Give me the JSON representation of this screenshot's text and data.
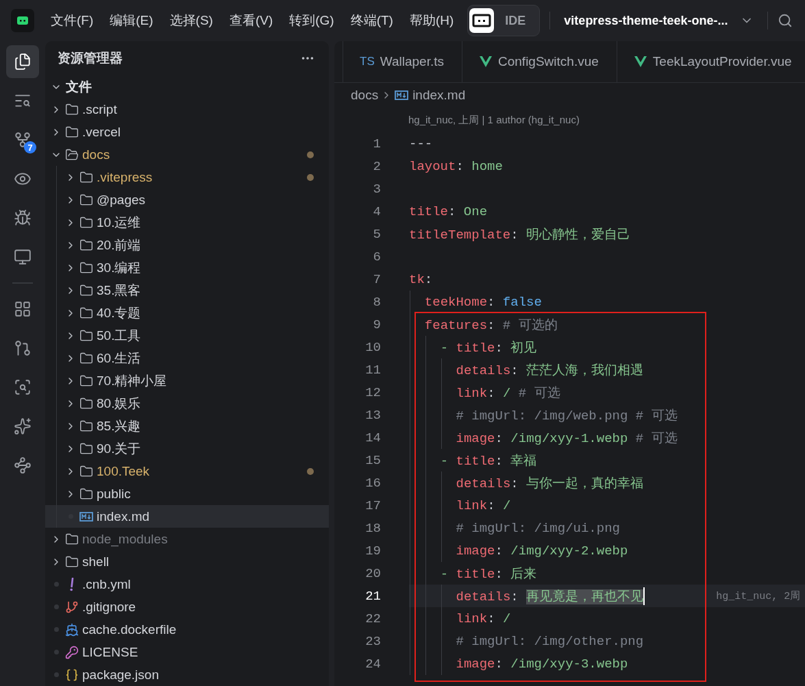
{
  "menu_bar": {
    "items": [
      "文件(F)",
      "编辑(E)",
      "选择(S)",
      "查看(V)",
      "转到(G)",
      "终端(T)",
      "帮助(H)"
    ],
    "mode_switch": {
      "label": "IDE",
      "on": true
    },
    "project": "vitepress-theme-teek-one-..."
  },
  "activity_bar": {
    "top": [
      {
        "kind": "explorer",
        "selected": true
      },
      {
        "kind": "search",
        "selected": false
      },
      {
        "kind": "source-control",
        "selected": false,
        "badge": "7"
      },
      {
        "kind": "preview",
        "selected": false
      },
      {
        "kind": "debug",
        "selected": false
      },
      {
        "kind": "remote",
        "selected": false
      }
    ],
    "bottom": [
      {
        "kind": "extensions",
        "selected": false
      },
      {
        "kind": "pull-requests",
        "selected": false
      },
      {
        "kind": "scan",
        "selected": false
      },
      {
        "kind": "ai",
        "selected": false
      },
      {
        "kind": "flow",
        "selected": false
      }
    ]
  },
  "explorer": {
    "title": "资源管理器",
    "section": {
      "label": "文件",
      "expanded": true
    },
    "tree": [
      {
        "label": ".script",
        "kind": "folder",
        "expanded": false,
        "modified": false,
        "ignored": false,
        "selected": false
      },
      {
        "label": ".vercel",
        "kind": "folder",
        "expanded": false,
        "modified": false,
        "ignored": false,
        "selected": false
      },
      {
        "label": "docs",
        "kind": "folder",
        "expanded": true,
        "modified": true,
        "ignored": false,
        "selected": false,
        "children": [
          {
            "label": ".vitepress",
            "kind": "folder",
            "expanded": false,
            "modified": true,
            "ignored": false,
            "selected": false
          },
          {
            "label": "@pages",
            "kind": "folder",
            "expanded": false,
            "modified": false,
            "ignored": false,
            "selected": false
          },
          {
            "label": "10.运维",
            "kind": "folder",
            "expanded": false,
            "modified": false,
            "ignored": false,
            "selected": false
          },
          {
            "label": "20.前端",
            "kind": "folder",
            "expanded": false,
            "modified": false,
            "ignored": false,
            "selected": false
          },
          {
            "label": "30.编程",
            "kind": "folder",
            "expanded": false,
            "modified": false,
            "ignored": false,
            "selected": false
          },
          {
            "label": "35.黑客",
            "kind": "folder",
            "expanded": false,
            "modified": false,
            "ignored": false,
            "selected": false
          },
          {
            "label": "40.专题",
            "kind": "folder",
            "expanded": false,
            "modified": false,
            "ignored": false,
            "selected": false
          },
          {
            "label": "50.工具",
            "kind": "folder",
            "expanded": false,
            "modified": false,
            "ignored": false,
            "selected": false
          },
          {
            "label": "60.生活",
            "kind": "folder",
            "expanded": false,
            "modified": false,
            "ignored": false,
            "selected": false
          },
          {
            "label": "70.精神小屋",
            "kind": "folder",
            "expanded": false,
            "modified": false,
            "ignored": false,
            "selected": false
          },
          {
            "label": "80.娱乐",
            "kind": "folder",
            "expanded": false,
            "modified": false,
            "ignored": false,
            "selected": false
          },
          {
            "label": "85.兴趣",
            "kind": "folder",
            "expanded": false,
            "modified": false,
            "ignored": false,
            "selected": false
          },
          {
            "label": "90.关于",
            "kind": "folder",
            "expanded": false,
            "modified": false,
            "ignored": false,
            "selected": false
          },
          {
            "label": "100.Teek",
            "kind": "folder",
            "expanded": false,
            "modified": true,
            "ignored": false,
            "selected": false
          },
          {
            "label": "public",
            "kind": "folder",
            "expanded": false,
            "modified": false,
            "ignored": false,
            "selected": false
          },
          {
            "label": "index.md",
            "kind": "markdown",
            "modified": false,
            "ignored": false,
            "selected": true
          }
        ]
      },
      {
        "label": "node_modules",
        "kind": "folder",
        "expanded": false,
        "modified": false,
        "ignored": true,
        "selected": false
      },
      {
        "label": "shell",
        "kind": "folder",
        "expanded": false,
        "modified": false,
        "ignored": false,
        "selected": false
      },
      {
        "label": ".cnb.yml",
        "kind": "yaml",
        "modified": false,
        "ignored": false,
        "selected": false
      },
      {
        "label": ".gitignore",
        "kind": "git",
        "modified": false,
        "ignored": false,
        "selected": false
      },
      {
        "label": "cache.dockerfile",
        "kind": "docker",
        "modified": false,
        "ignored": false,
        "selected": false
      },
      {
        "label": "LICENSE",
        "kind": "license",
        "modified": false,
        "ignored": false,
        "selected": false
      },
      {
        "label": "package.json",
        "kind": "json",
        "modified": false,
        "ignored": false,
        "selected": false
      }
    ]
  },
  "editor": {
    "tabs": [
      {
        "label": "Wallaper.ts",
        "kind": "ts",
        "icon_text": "TS",
        "selected": false
      },
      {
        "label": "ConfigSwitch.vue",
        "kind": "vue",
        "selected": false
      },
      {
        "label": "TeekLayoutProvider.vue",
        "kind": "vue",
        "selected": false
      }
    ],
    "breadcrumb": [
      {
        "label": "docs",
        "kind": "folder"
      },
      {
        "label": "index.md",
        "kind": "markdown"
      }
    ],
    "blame_header": "hg_it_nuc, 上周 | 1 author (hg_it_nuc)",
    "lines": [
      {
        "number": "1",
        "current": false,
        "boxed": false,
        "tokens": [
          {
            "kind": "plain",
            "text": "---"
          }
        ]
      },
      {
        "number": "2",
        "current": false,
        "boxed": false,
        "tokens": [
          {
            "kind": "key",
            "text": "layout"
          },
          {
            "kind": "plain",
            "text": ": "
          },
          {
            "kind": "str",
            "text": "home"
          }
        ]
      },
      {
        "number": "3",
        "current": false,
        "boxed": false
      },
      {
        "number": "4",
        "current": false,
        "boxed": false,
        "tokens": [
          {
            "kind": "key",
            "text": "title"
          },
          {
            "kind": "plain",
            "text": ": "
          },
          {
            "kind": "str",
            "text": "One"
          }
        ]
      },
      {
        "number": "5",
        "current": false,
        "boxed": false,
        "tokens": [
          {
            "kind": "key",
            "text": "titleTemplate"
          },
          {
            "kind": "plain",
            "text": ": "
          },
          {
            "kind": "str",
            "text": "明心静性，爱自己"
          }
        ]
      },
      {
        "number": "6",
        "current": false,
        "boxed": false
      },
      {
        "number": "7",
        "current": false,
        "boxed": false,
        "tokens": [
          {
            "kind": "key",
            "text": "tk"
          },
          {
            "kind": "plain",
            "text": ":"
          }
        ],
        "children": [
          {
            "number": "8",
            "current": false,
            "boxed": false,
            "tokens": [
              {
                "kind": "key",
                "text": "teekHome"
              },
              {
                "kind": "plain",
                "text": ": "
              },
              {
                "kind": "bool",
                "text": "false"
              }
            ]
          },
          {
            "number": "9",
            "current": false,
            "boxed": true,
            "tokens": [
              {
                "kind": "key",
                "text": "features"
              },
              {
                "kind": "plain",
                "text": ": "
              },
              {
                "kind": "comment",
                "text": "# 可选的"
              }
            ],
            "children": [
              {
                "number": "10",
                "current": false,
                "boxed": true,
                "tokens": [
                  {
                    "kind": "str",
                    "text": "- "
                  },
                  {
                    "kind": "key",
                    "text": "title"
                  },
                  {
                    "kind": "plain",
                    "text": ": "
                  },
                  {
                    "kind": "str",
                    "text": "初见"
                  }
                ],
                "children": [
                  {
                    "number": "11",
                    "current": false,
                    "boxed": true,
                    "tokens": [
                      {
                        "kind": "key",
                        "text": "details"
                      },
                      {
                        "kind": "plain",
                        "text": ": "
                      },
                      {
                        "kind": "str",
                        "text": "茫茫人海，我们相遇"
                      }
                    ]
                  },
                  {
                    "number": "12",
                    "current": false,
                    "boxed": true,
                    "tokens": [
                      {
                        "kind": "key",
                        "text": "link"
                      },
                      {
                        "kind": "plain",
                        "text": ": "
                      },
                      {
                        "kind": "str",
                        "text": "/"
                      },
                      {
                        "kind": "comment",
                        "text": "# 可选"
                      }
                    ]
                  },
                  {
                    "number": "13",
                    "current": false,
                    "boxed": true,
                    "tokens": [
                      {
                        "kind": "comment",
                        "text": "# imgUrl: /img/web.png # 可选"
                      }
                    ]
                  },
                  {
                    "number": "14",
                    "current": false,
                    "boxed": true,
                    "tokens": [
                      {
                        "kind": "key",
                        "text": "image"
                      },
                      {
                        "kind": "plain",
                        "text": ": "
                      },
                      {
                        "kind": "str",
                        "text": "/img/xyy-1.webp"
                      },
                      {
                        "kind": "comment",
                        "text": "# 可选"
                      }
                    ]
                  }
                ]
              },
              {
                "number": "15",
                "current": false,
                "boxed": true,
                "tokens": [
                  {
                    "kind": "str",
                    "text": "- "
                  },
                  {
                    "kind": "key",
                    "text": "title"
                  },
                  {
                    "kind": "plain",
                    "text": ": "
                  },
                  {
                    "kind": "str",
                    "text": "幸福"
                  }
                ],
                "children": [
                  {
                    "number": "16",
                    "current": false,
                    "boxed": true,
                    "tokens": [
                      {
                        "kind": "key",
                        "text": "details"
                      },
                      {
                        "kind": "plain",
                        "text": ": "
                      },
                      {
                        "kind": "str",
                        "text": "与你一起，真的幸福"
                      }
                    ]
                  },
                  {
                    "number": "17",
                    "current": false,
                    "boxed": true,
                    "tokens": [
                      {
                        "kind": "key",
                        "text": "link"
                      },
                      {
                        "kind": "plain",
                        "text": ": "
                      },
                      {
                        "kind": "str",
                        "text": "/"
                      }
                    ]
                  },
                  {
                    "number": "18",
                    "current": false,
                    "boxed": true,
                    "tokens": [
                      {
                        "kind": "comment",
                        "text": "# imgUrl: /img/ui.png"
                      }
                    ]
                  },
                  {
                    "number": "19",
                    "current": false,
                    "boxed": true,
                    "tokens": [
                      {
                        "kind": "key",
                        "text": "image"
                      },
                      {
                        "kind": "plain",
                        "text": ": "
                      },
                      {
                        "kind": "str",
                        "text": "/img/xyy-2.webp"
                      }
                    ]
                  }
                ]
              },
              {
                "number": "20",
                "current": false,
                "boxed": true,
                "tokens": [
                  {
                    "kind": "str",
                    "text": "- "
                  },
                  {
                    "kind": "key",
                    "text": "title"
                  },
                  {
                    "kind": "plain",
                    "text": ": "
                  },
                  {
                    "kind": "str",
                    "text": "后来"
                  }
                ],
                "children": [
                  {
                    "number": "21",
                    "current": true,
                    "boxed": true,
                    "blame": "hg_it_nuc, 2周",
                    "tokens": [
                      {
                        "kind": "key",
                        "text": "details"
                      },
                      {
                        "kind": "plain",
                        "text": ": "
                      },
                      {
                        "kind": "selection",
                        "text": "再见竟是，再也不见"
                      }
                    ]
                  },
                  {
                    "number": "22",
                    "current": false,
                    "boxed": true,
                    "tokens": [
                      {
                        "kind": "key",
                        "text": "link"
                      },
                      {
                        "kind": "plain",
                        "text": ": "
                      },
                      {
                        "kind": "str",
                        "text": "/"
                      }
                    ]
                  },
                  {
                    "number": "23",
                    "current": false,
                    "boxed": true,
                    "tokens": [
                      {
                        "kind": "comment",
                        "text": "# imgUrl: /img/other.png"
                      }
                    ]
                  },
                  {
                    "number": "24",
                    "current": false,
                    "boxed": true,
                    "tokens": [
                      {
                        "kind": "key",
                        "text": "image"
                      },
                      {
                        "kind": "plain",
                        "text": ": "
                      },
                      {
                        "kind": "str",
                        "text": "/img/xyy-3.webp"
                      }
                    ]
                  }
                ]
              }
            ]
          }
        ]
      }
    ]
  }
}
